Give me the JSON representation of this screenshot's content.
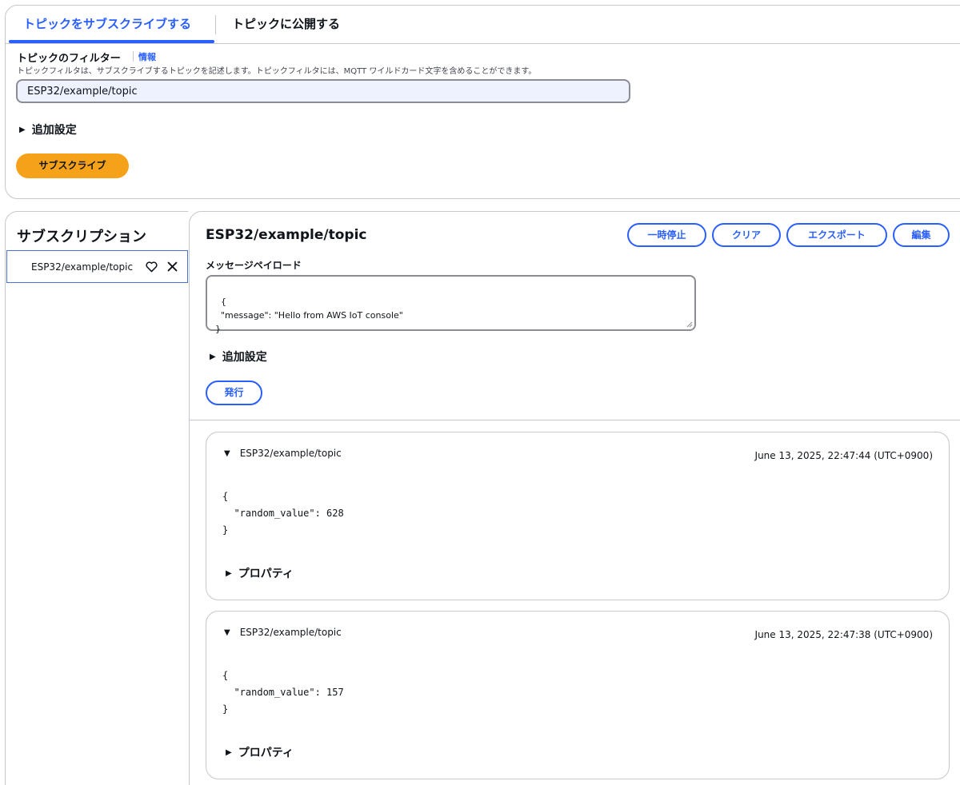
{
  "tabs": {
    "subscribe": "トピックをサブスクライブする",
    "publish": "トピックに公開する"
  },
  "filter": {
    "label": "トピックのフィルター",
    "info": "情報",
    "description": "トピックフィルタは、サブスクライブするトピックを記述します。トピックフィルタには、MQTT ワイルドカード文字を含めることができます。",
    "value": "ESP32/example/topic",
    "additional_settings": "追加設定",
    "subscribe_button": "サブスクライブ"
  },
  "subscriptions": {
    "title": "サブスクリプション",
    "items": [
      {
        "label": "ESP32/example/topic"
      }
    ]
  },
  "topic_panel": {
    "title": "ESP32/example/topic",
    "buttons": {
      "pause": "一時停止",
      "clear": "クリア",
      "export": "エクスポート",
      "edit": "編集"
    },
    "payload_label": "メッセージペイロード",
    "payload_value": "{\n  \"message\": \"Hello from AWS IoT console\"\n}",
    "additional_settings": "追加設定",
    "publish_button": "発行"
  },
  "messages": [
    {
      "topic": "ESP32/example/topic",
      "timestamp": "June 13, 2025, 22:47:44 (UTC+0900)",
      "body": "{\n  \"random_value\": 628\n}",
      "properties": "プロパティ"
    },
    {
      "topic": "ESP32/example/topic",
      "timestamp": "June 13, 2025, 22:47:38 (UTC+0900)",
      "body": "{\n  \"random_value\": 157\n}",
      "properties": "プロパティ"
    }
  ],
  "icons": {
    "expand": "triangle-right",
    "collapse": "triangle-down",
    "favorite": "heart-outline",
    "remove": "x-close"
  },
  "colors": {
    "accent": "#295eff",
    "subscribe_button": "#f5a11a",
    "border": "#c6c6cd",
    "input_bg": "#eef2ff"
  }
}
